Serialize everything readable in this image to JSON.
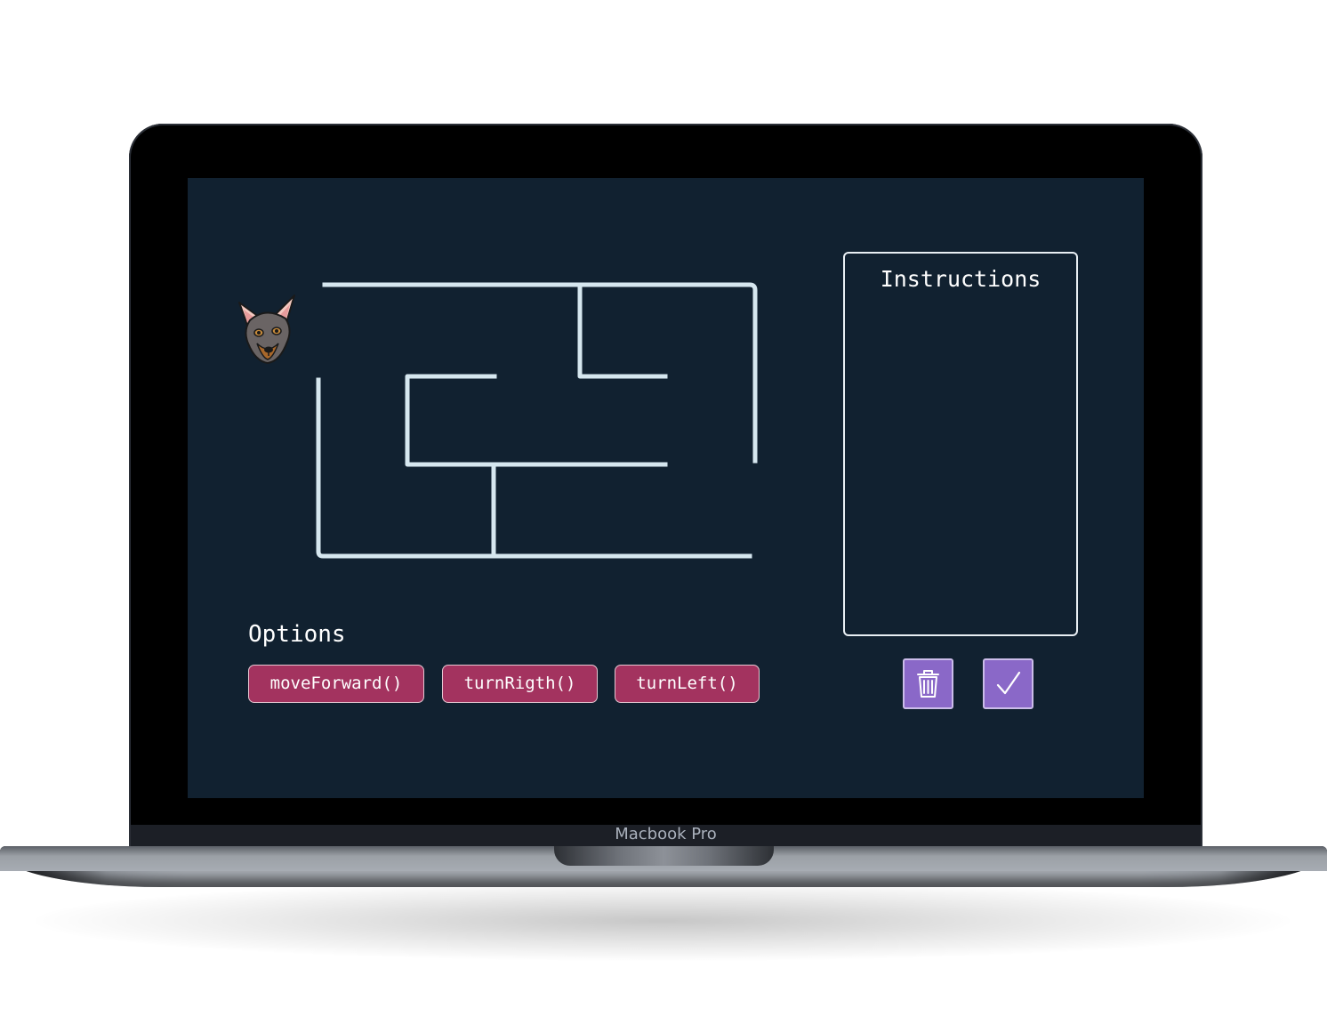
{
  "device": {
    "brand_label": "Macbook Pro"
  },
  "game": {
    "character_icon": "dog-head-icon",
    "options": {
      "title": "Options",
      "buttons": [
        "moveForward()",
        "turnRigth()",
        "turnLeft()"
      ]
    },
    "instructions": {
      "title": "Instructions",
      "items": []
    },
    "actions": {
      "delete_icon": "trash-icon",
      "confirm_icon": "check-icon"
    }
  },
  "colors": {
    "screen_background": "#112130",
    "maze_walls": "#d6e7ef",
    "option_button": "#a3335f",
    "action_button": "#8a68c8"
  }
}
